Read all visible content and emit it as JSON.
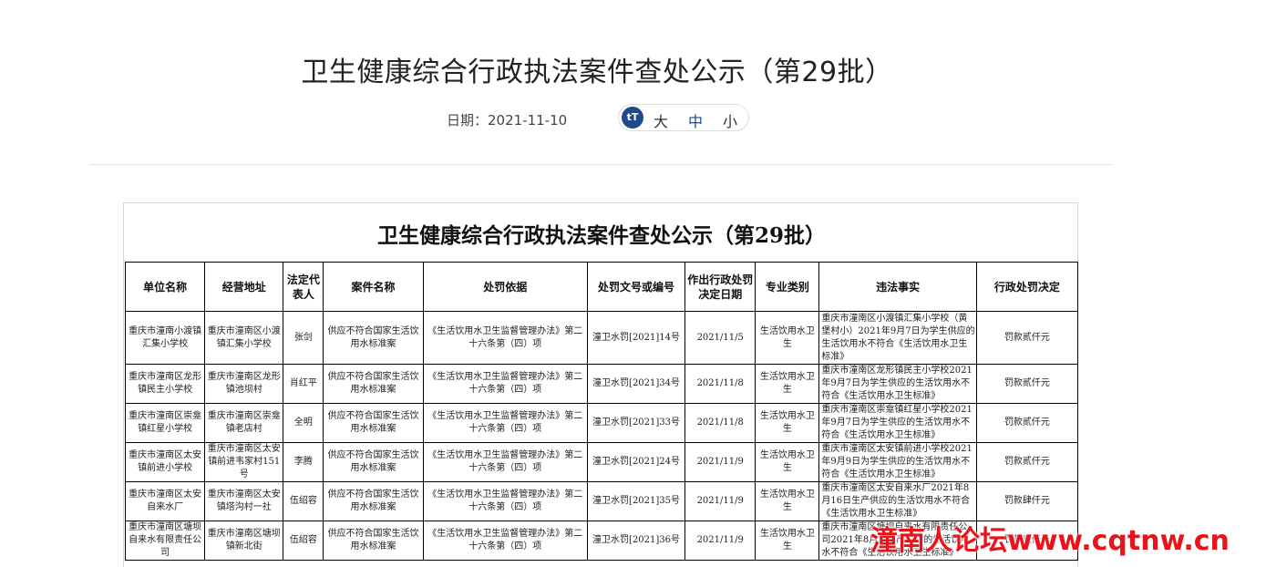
{
  "page": {
    "title": "卫生健康综合行政执法案件查处公示（第29批）",
    "date_label": "日期：2021-11-10",
    "font_icon": "tT",
    "font_sizes": [
      "大",
      "中",
      "小"
    ]
  },
  "document": {
    "title": "卫生健康综合行政执法案件查处公示（第29批）",
    "headers": [
      "单位名称",
      "经营地址",
      "法定代表人",
      "案件名称",
      "处罚依据",
      "处罚文号或编号",
      "作出行政处罚决定日期",
      "专业类别",
      "违法事实",
      "行政处罚决定"
    ],
    "rows": [
      [
        "重庆市潼南小渡镇汇集小学校",
        "重庆市潼南区小渡镇汇集小学校",
        "张剑",
        "供应不符合国家生活饮用水标准案",
        "《生活饮用水卫生监督管理办法》第二十六条第（四）项",
        "潼卫水罚[2021]14号",
        "2021/11/5",
        "生活饮用水卫生",
        "重庆市潼南区小渡镇汇集小学校（黄堡村小）2021年9月7日为学生供应的生活饮用水不符合《生活饮用水卫生标准》",
        "罚款贰仟元"
      ],
      [
        "重庆市潼南区龙形镇民主小学校",
        "重庆市潼南区龙形镇池坝村",
        "肖红平",
        "供应不符合国家生活饮用水标准案",
        "《生活饮用水卫生监督管理办法》第二十六条第（四）项",
        "潼卫水罚[2021]34号",
        "2021/11/8",
        "生活饮用水卫生",
        "重庆市潼南区龙形镇民主小学校2021年9月7日为学生供应的生活饮用水不符合《生活饮用水卫生标准》",
        "罚款贰仟元"
      ],
      [
        "重庆市潼南区崇龛镇红星小学校",
        "重庆市潼南区崇龛镇老店村",
        "全明",
        "供应不符合国家生活饮用水标准案",
        "《生活饮用水卫生监督管理办法》第二十六条第（四）项",
        "潼卫水罚[2021]33号",
        "2021/11/8",
        "生活饮用水卫生",
        "重庆市潼南区崇龛镇红星小学校2021年9月7日为学生供应的生活饮用水不符合《生活饮用水卫生标准》",
        "罚款贰仟元"
      ],
      [
        "重庆市潼南区太安镇前进小学校",
        "重庆市潼南区太安镇前进韦家村151号",
        "李腾",
        "供应不符合国家生活饮用水标准案",
        "《生活饮用水卫生监督管理办法》第二十六条第（四）项",
        "潼卫水罚[2021]24号",
        "2021/11/9",
        "生活饮用水卫生",
        "重庆市潼南区太安镇前进小学校2021年9月9日为学生供应的生活饮用水不符合《生活饮用水卫生标准》",
        "罚款贰仟元"
      ],
      [
        "重庆市潼南区太安自来水厂",
        "重庆市潼南区太安镇塔沟村一社",
        "伍绍容",
        "供应不符合国家生活饮用水标准案",
        "《生活饮用水卫生监督管理办法》第二十六条第（四）项",
        "潼卫水罚[2021]35号",
        "2021/11/9",
        "生活饮用水卫生",
        "重庆市潼南区太安自来水厂2021年8月16日生产供应的生活饮用水不符合《生活饮用水卫生标准》",
        "罚款肆仟元"
      ],
      [
        "重庆市潼南区塘坝自来水有限责任公司",
        "重庆市潼南区塘坝镇新北街",
        "伍绍容",
        "供应不符合国家生活饮用水标准案",
        "《生活饮用水卫生监督管理办法》第二十六条第（四）项",
        "潼卫水罚[2021]36号",
        "2021/11/9",
        "生活饮用水卫生",
        "重庆市潼南区塘坝自来水有限责任公司2021年8月…生产供应的生活饮用水不符合《生活饮用水卫生标准》",
        "罚款贰仟元"
      ]
    ]
  },
  "watermark": "潼南人论坛www.cqtnw.cn"
}
